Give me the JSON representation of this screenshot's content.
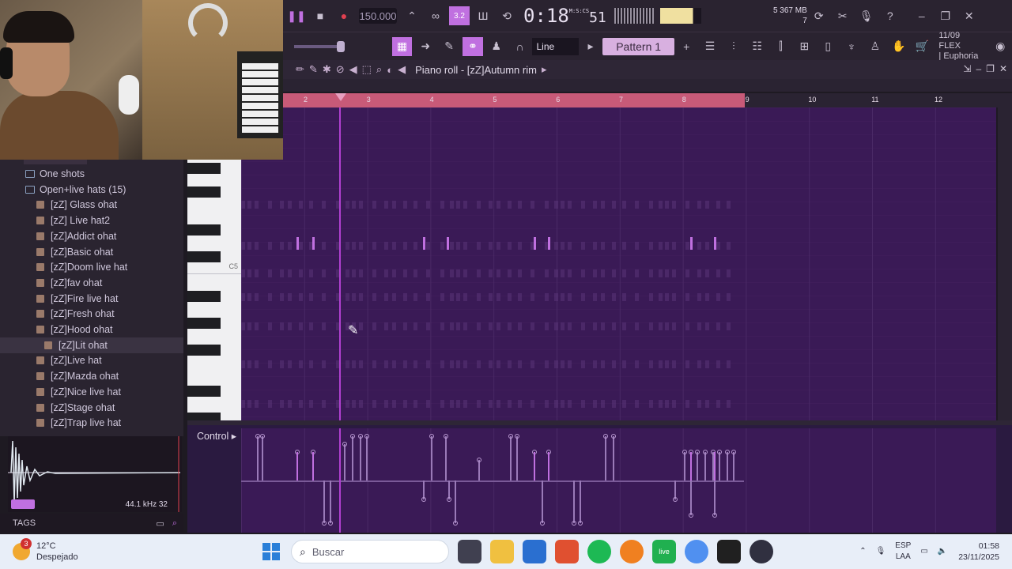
{
  "toolbar": {
    "tempo": "150.000",
    "time": "0:18",
    "time_sub": "51",
    "time_unit": "M:S:CS",
    "cpu_line1": "5     367 MB",
    "cpu_line2": "7",
    "pattern": "Pattern 1",
    "snap": "Line",
    "song_date": "11/09 FLEX",
    "song_name": "| Euphoria"
  },
  "piano_roll": {
    "title": "Piano roll - [zZ]Autumn rim",
    "ruler": [
      "2",
      "3",
      "4",
      "5",
      "6",
      "7",
      "8",
      "9",
      "10",
      "11",
      "12"
    ],
    "key_label": "C5",
    "control_label": "Control"
  },
  "browser": {
    "items": [
      {
        "label": "One shots",
        "type": "folder"
      },
      {
        "label": "Open+live hats (15)",
        "type": "folder"
      },
      {
        "label": "[zZ] Glass ohat",
        "type": "file"
      },
      {
        "label": "[zZ] Live hat2",
        "type": "file"
      },
      {
        "label": "[zZ]Addict ohat",
        "type": "file"
      },
      {
        "label": "[zZ]Basic ohat",
        "type": "file"
      },
      {
        "label": "[zZ]Doom live hat",
        "type": "file"
      },
      {
        "label": "[zZ]fav ohat",
        "type": "file"
      },
      {
        "label": "[zZ]Fire live hat",
        "type": "file"
      },
      {
        "label": "[zZ]Fresh ohat",
        "type": "file"
      },
      {
        "label": "[zZ]Hood ohat",
        "type": "file"
      },
      {
        "label": "[zZ]Lit ohat",
        "type": "file",
        "selected": true
      },
      {
        "label": "[zZ]Live hat",
        "type": "file"
      },
      {
        "label": "[zZ]Mazda ohat",
        "type": "file"
      },
      {
        "label": "[zZ]Nice live hat",
        "type": "file"
      },
      {
        "label": "[zZ]Stage ohat",
        "type": "file"
      },
      {
        "label": "[zZ]Trap live hat",
        "type": "file"
      }
    ],
    "sample_info": "44.1 kHz 32",
    "tags_label": "TAGS"
  },
  "taskbar": {
    "weather_temp": "12°C",
    "weather_desc": "Despejado",
    "notif_count": "3",
    "search_placeholder": "Buscar",
    "lang1": "ESP",
    "lang2": "LAA",
    "time": "01:58",
    "date": "23/11/2025"
  },
  "colors": {
    "grid": "#3a1a56",
    "loop": "#c85a78",
    "note": "#c070e0"
  }
}
